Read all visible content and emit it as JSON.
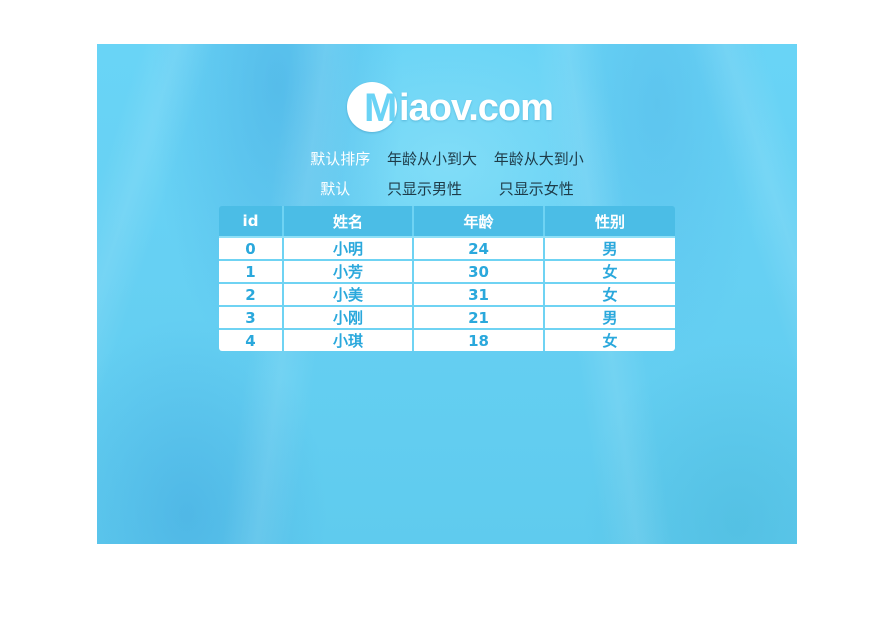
{
  "logo": {
    "badge_letter": "M",
    "rest_text": "iaov.com"
  },
  "sort_options": [
    {
      "label": "默认排序",
      "active": true
    },
    {
      "label": "年龄从小到大",
      "active": false
    },
    {
      "label": "年龄从大到小",
      "active": false
    }
  ],
  "filter_options": [
    {
      "label": "默认",
      "active": true
    },
    {
      "label": "只显示男性",
      "active": false
    },
    {
      "label": "只显示女性",
      "active": false
    }
  ],
  "table": {
    "headers": [
      "id",
      "姓名",
      "年龄",
      "性别"
    ],
    "rows": [
      [
        "0",
        "小明",
        "24",
        "男"
      ],
      [
        "1",
        "小芳",
        "30",
        "女"
      ],
      [
        "2",
        "小美",
        "31",
        "女"
      ],
      [
        "3",
        "小刚",
        "21",
        "男"
      ],
      [
        "4",
        "小琪",
        "18",
        "女"
      ]
    ]
  },
  "colors": {
    "background": "#66d0f3",
    "header_bg": "#4bbde6",
    "cell_text": "#2aa8dc",
    "active_option": "#ffffff",
    "inactive_option": "#1e3b48"
  }
}
